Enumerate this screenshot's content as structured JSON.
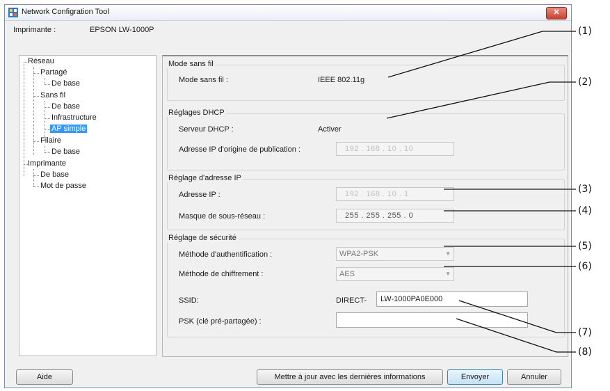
{
  "window": {
    "title": "Network Configration Tool",
    "close_glyph": "✕"
  },
  "printer": {
    "label": "Imprimante :",
    "value": "EPSON LW-1000P"
  },
  "tree": {
    "reseau": "Réseau",
    "partage": "Partagé",
    "partage_base": "De base",
    "sans_fil": "Sans fil",
    "sans_fil_base": "De base",
    "infrastructure": "Infrastructure",
    "ap_simple": "AP simple",
    "filaire": "Filaire",
    "filaire_base": "De base",
    "imprimante": "Imprimante",
    "imprimante_base": "De base",
    "mot_de_passe": "Mot de passe"
  },
  "wireless": {
    "title": "Mode sans fil",
    "label": "Mode sans fil :",
    "value": "IEEE 802.11g"
  },
  "dhcp": {
    "title": "Réglages DHCP",
    "server_label": "Serveur DHCP :",
    "server_value": "Activer",
    "origin_label": "Adresse IP d'origine de publication :",
    "origin_value": "192  .  168  .  10  .  10"
  },
  "ip": {
    "title": "Réglage d'adresse IP",
    "address_label": "Adresse IP :",
    "address_value": "192  .  168  .  10  .  1",
    "mask_label": "Masque de sous-réseau :",
    "mask_value": "255  .  255  .  255  .  0"
  },
  "security": {
    "title": "Réglage de sécurité",
    "auth_label": "Méthode d'authentification :",
    "auth_value": "WPA2-PSK",
    "enc_label": "Méthode de chiffrement :",
    "enc_value": "AES",
    "ssid_label": "SSID:",
    "ssid_prefix": "DIRECT-",
    "ssid_value": "LW-1000PA0E000",
    "psk_label": "PSK (clé pré-partagée) :",
    "psk_value": ""
  },
  "buttons": {
    "help": "Aide",
    "refresh": "Mettre à jour avec les dernières informations",
    "send": "Envoyer",
    "cancel": "Annuler"
  },
  "callouts": [
    "(1)",
    "(2)",
    "(3)",
    "(4)",
    "(5)",
    "(6)",
    "(7)",
    "(8)"
  ],
  "icons": {
    "dropdown": "dropdown-arrow-icon",
    "app": "network-app-icon",
    "close": "close-icon"
  },
  "colors": {
    "selection": "#3399ff",
    "close_button": "#c5422f",
    "primary_button_border": "#3c7fb1"
  }
}
